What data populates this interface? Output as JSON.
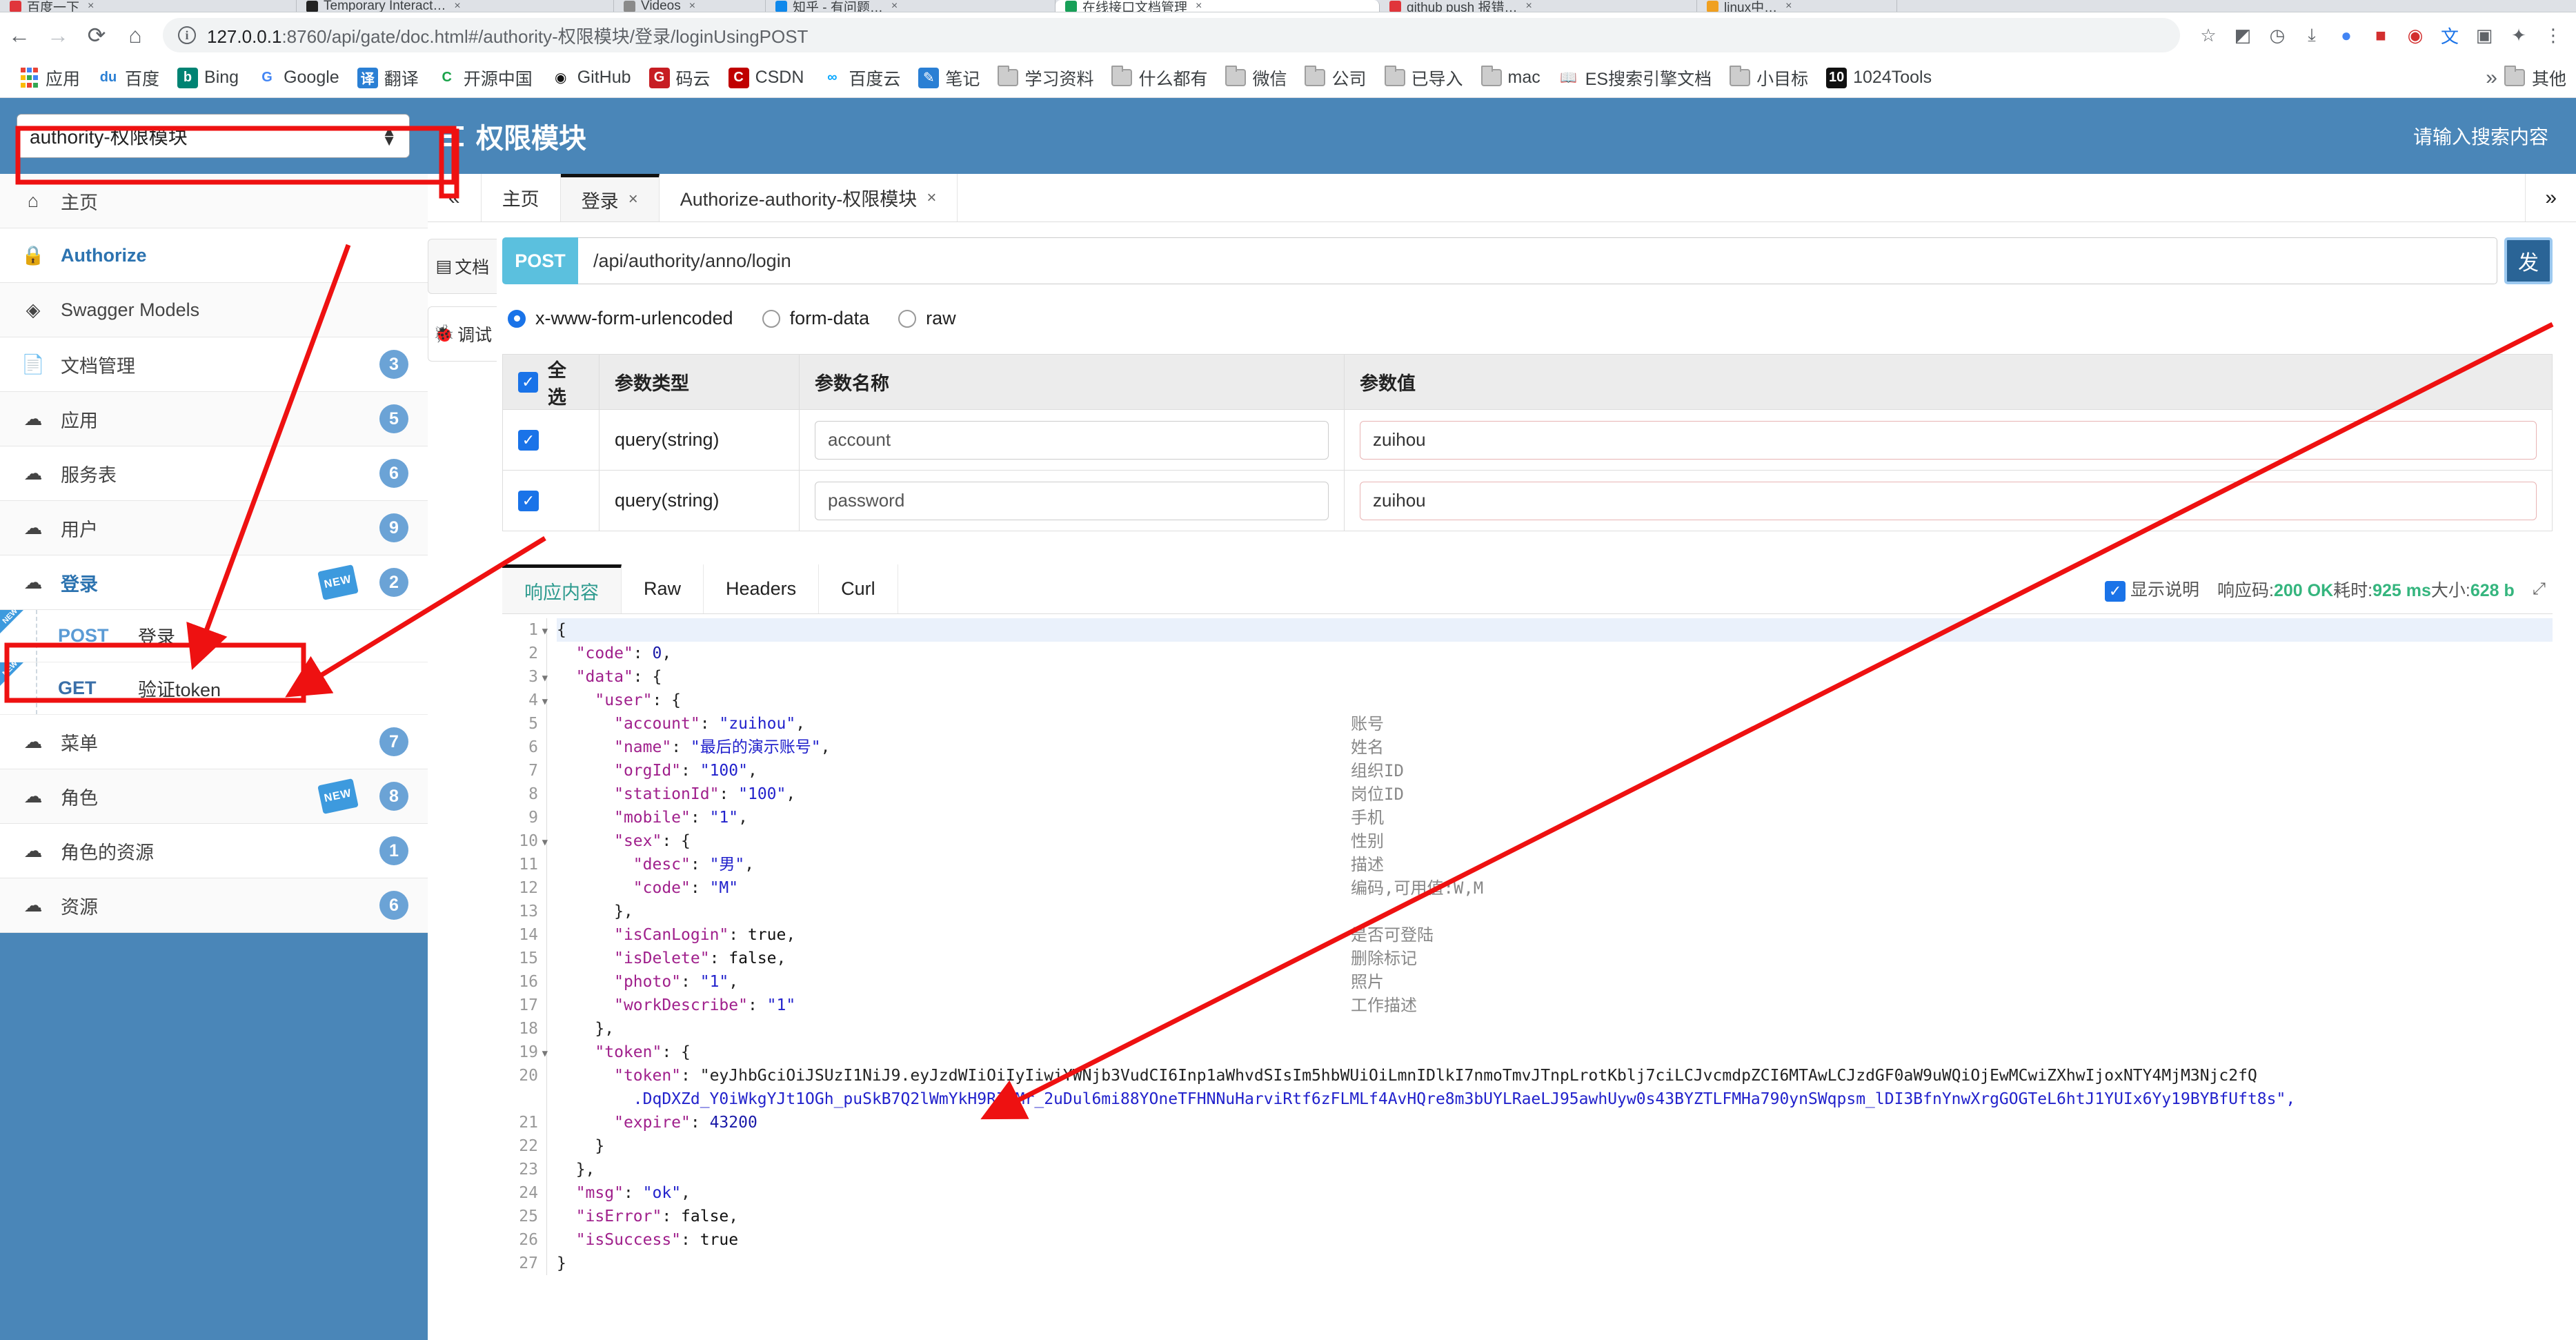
{
  "browser": {
    "tabs": [
      {
        "title": "百度一下",
        "favicon_color": "#e0353b",
        "active": false
      },
      {
        "title": "Temporary Interact…",
        "favicon_color": "#222222",
        "active": false
      },
      {
        "title": "Videos",
        "favicon_color": "#8a8a8a",
        "active": false
      },
      {
        "title": "知乎 - 有问题…",
        "favicon_color": "#0f88eb",
        "active": false
      },
      {
        "title": "在线接口文档管理",
        "favicon_color": "#18a058",
        "active": true
      },
      {
        "title": "github push 报错…",
        "favicon_color": "#e0353b",
        "active": false
      },
      {
        "title": "linux中…",
        "favicon_color": "#f0a020",
        "active": false
      }
    ],
    "nav": {
      "back": "←",
      "forward": "→",
      "reload": "⟳",
      "home": "⌂"
    },
    "url_prefix": "127.0.0.1",
    "url_rest": ":8760/api/gate/doc.html#/authority-权限模块/登录/loginUsingPOST",
    "toolbar_icons": [
      "star-icon",
      "extension-icon",
      "history-icon",
      "download-icon",
      "profile-icon",
      "lastpass-icon",
      "adblock-icon",
      "translate-icon",
      "zip-icon",
      "puzzle-icon",
      "menu-icon"
    ],
    "bookmarks": [
      {
        "label": "应用",
        "icon": "apps-grid-icon",
        "type": "apps"
      },
      {
        "label": "百度",
        "icon": "baidu-icon",
        "type": "site",
        "color": "#2a7fd4"
      },
      {
        "label": "Bing",
        "icon": "bing-icon",
        "type": "site",
        "color": "#008373"
      },
      {
        "label": "Google",
        "icon": "google-icon",
        "type": "site",
        "color": "#4285f4"
      },
      {
        "label": "翻译",
        "icon": "translate-icon",
        "type": "site",
        "color": "#2a7fd4"
      },
      {
        "label": "开源中国",
        "icon": "oschina-icon",
        "type": "site",
        "color": "#1aa34a"
      },
      {
        "label": "GitHub",
        "icon": "github-icon",
        "type": "site",
        "color": "#111111"
      },
      {
        "label": "码云",
        "icon": "gitee-icon",
        "type": "site",
        "color": "#c71d23"
      },
      {
        "label": "CSDN",
        "icon": "csdn-icon",
        "type": "site",
        "color": "#c00000"
      },
      {
        "label": "百度云",
        "icon": "baiduyun-icon",
        "type": "site",
        "color": "#06a7ff"
      },
      {
        "label": "笔记",
        "icon": "note-icon",
        "type": "site",
        "color": "#2a7fd4"
      },
      {
        "label": "学习资料",
        "icon": "folder-icon",
        "type": "folder"
      },
      {
        "label": "什么都有",
        "icon": "folder-icon",
        "type": "folder"
      },
      {
        "label": "微信",
        "icon": "folder-icon",
        "type": "folder"
      },
      {
        "label": "公司",
        "icon": "folder-icon",
        "type": "folder"
      },
      {
        "label": "已导入",
        "icon": "folder-icon",
        "type": "folder"
      },
      {
        "label": "mac",
        "icon": "folder-icon",
        "type": "folder"
      },
      {
        "label": "ES搜索引擎文档",
        "icon": "book-icon",
        "type": "site",
        "color": "#333333"
      },
      {
        "label": "小目标",
        "icon": "folder-icon",
        "type": "folder"
      },
      {
        "label": "1024Tools",
        "icon": "tools-icon",
        "type": "site",
        "color": "#111111"
      }
    ],
    "bookmarks_overflow": "»",
    "other_bookmarks": "其他"
  },
  "app": {
    "module_select": {
      "value": "authority-权限模块"
    },
    "title": "权限模块",
    "search_placeholder": "请输入搜索内容",
    "sidebar": [
      {
        "label": "主页",
        "icon": "home-icon",
        "badge": "",
        "new": false,
        "active": false,
        "type": "nav"
      },
      {
        "label": "Authorize",
        "icon": "lock-icon",
        "badge": "",
        "new": false,
        "active": true,
        "type": "nav"
      },
      {
        "label": "Swagger Models",
        "icon": "model-icon",
        "badge": "",
        "new": false,
        "active": false,
        "type": "nav"
      },
      {
        "label": "文档管理",
        "icon": "doc-gear-icon",
        "badge": "3",
        "new": false,
        "active": false,
        "type": "group"
      },
      {
        "label": "应用",
        "icon": "api-cloud-icon",
        "badge": "5",
        "new": false,
        "active": false,
        "type": "group"
      },
      {
        "label": "服务表",
        "icon": "api-cloud-icon",
        "badge": "6",
        "new": false,
        "active": false,
        "type": "group"
      },
      {
        "label": "用户",
        "icon": "api-cloud-icon",
        "badge": "9",
        "new": false,
        "active": false,
        "type": "group"
      },
      {
        "label": "登录",
        "icon": "api-cloud-icon",
        "badge": "2",
        "new": true,
        "active": true,
        "type": "group"
      }
    ],
    "sidebar_ops": [
      {
        "method": "POST",
        "name": "登录",
        "new": true,
        "selected": true
      },
      {
        "method": "GET",
        "name": "验证token",
        "new": true,
        "selected": false
      }
    ],
    "sidebar_tail": [
      {
        "label": "菜单",
        "icon": "api-cloud-icon",
        "badge": "7",
        "new": false
      },
      {
        "label": "角色",
        "icon": "api-cloud-icon",
        "badge": "8",
        "new": true
      },
      {
        "label": "角色的资源",
        "icon": "api-cloud-icon",
        "badge": "1",
        "new": false
      },
      {
        "label": "资源",
        "icon": "api-cloud-icon",
        "badge": "6",
        "new": false
      }
    ],
    "new_tag": "NEW"
  },
  "content": {
    "collapse_icon": "«",
    "expand_icon": "»",
    "tabs": [
      {
        "label": "主页",
        "closable": false,
        "selected": false
      },
      {
        "label": "登录",
        "closable": true,
        "selected": true
      },
      {
        "label": "Authorize-authority-权限模块",
        "closable": true,
        "selected": false
      }
    ],
    "close_glyph": "×",
    "vtabs": [
      {
        "label": "文档",
        "icon": "document-icon",
        "selected": false
      },
      {
        "label": "调试",
        "icon": "bug-icon",
        "selected": true
      }
    ],
    "request": {
      "method": "POST",
      "url": "/api/authority/anno/login",
      "send_label": "发"
    },
    "body_types": [
      {
        "label": "x-www-form-urlencoded",
        "selected": true
      },
      {
        "label": "form-data",
        "selected": false
      },
      {
        "label": "raw",
        "selected": false
      }
    ],
    "param_table": {
      "headers": [
        "全选",
        "参数类型",
        "参数名称",
        "参数值"
      ],
      "rows": [
        {
          "checked": true,
          "type": "query(string)",
          "name": "account",
          "value": "zuihou"
        },
        {
          "checked": true,
          "type": "query(string)",
          "name": "password",
          "value": "zuihou"
        }
      ]
    },
    "response_tabs": [
      {
        "label": "响应内容",
        "selected": true
      },
      {
        "label": "Raw",
        "selected": false
      },
      {
        "label": "Headers",
        "selected": false
      },
      {
        "label": "Curl",
        "selected": false
      }
    ],
    "response_meta": {
      "show_desc_label": "显示说明",
      "show_desc_checked": true,
      "status_label": "响应码:",
      "status_value": "200 OK",
      "time_label": "耗时:",
      "time_value": "925 ms",
      "size_label": "大小:",
      "size_value": "628 b",
      "expand_icon": "expand-icon"
    },
    "response_code_lines": [
      {
        "n": 1,
        "fold": true,
        "text": "{"
      },
      {
        "n": 2,
        "fold": false,
        "text": "  \"code\": 0,"
      },
      {
        "n": 3,
        "fold": true,
        "text": "  \"data\": {"
      },
      {
        "n": 4,
        "fold": true,
        "text": "    \"user\": {"
      },
      {
        "n": 5,
        "fold": false,
        "text": "      \"account\": \"zuihou\","
      },
      {
        "n": 6,
        "fold": false,
        "text": "      \"name\": \"最后的演示账号\","
      },
      {
        "n": 7,
        "fold": false,
        "text": "      \"orgId\": \"100\","
      },
      {
        "n": 8,
        "fold": false,
        "text": "      \"stationId\": \"100\","
      },
      {
        "n": 9,
        "fold": false,
        "text": "      \"mobile\": \"1\","
      },
      {
        "n": 10,
        "fold": true,
        "text": "      \"sex\": {"
      },
      {
        "n": 11,
        "fold": false,
        "text": "        \"desc\": \"男\","
      },
      {
        "n": 12,
        "fold": false,
        "text": "        \"code\": \"M\""
      },
      {
        "n": 13,
        "fold": false,
        "text": "      },"
      },
      {
        "n": 14,
        "fold": false,
        "text": "      \"isCanLogin\": true,"
      },
      {
        "n": 15,
        "fold": false,
        "text": "      \"isDelete\": false,"
      },
      {
        "n": 16,
        "fold": false,
        "text": "      \"photo\": \"1\","
      },
      {
        "n": 17,
        "fold": false,
        "text": "      \"workDescribe\": \"1\""
      },
      {
        "n": 18,
        "fold": false,
        "text": "    },"
      },
      {
        "n": 19,
        "fold": true,
        "text": "    \"token\": {"
      },
      {
        "n": 20,
        "fold": false,
        "text": "      \"token\": \"eyJhbGciOiJSUzI1NiJ9.eyJzdWIiOiIyIiwiYWNjb3VudCI6Inp1aWhvdSIsIm5hbWUiOiLmnIDlkI7nmoTmvJTnpLrotKblj7ciLCJvcmdpZCI6MTAwLCJzdGF0aW9uWQiOjEwMCwiZXhwIjoxNTY4MjM3Njc2fQ"
      },
      {
        "n": null,
        "fold": false,
        "text": "        .DqDXZd_Y0iWkgYJt1OGh_puSkB7Q2lWmYkH9RZYMr_2uDul6mi88YOneTFHNNuHarviRtf6zFLMLf4AvHQre8m3bUYLRaeLJ95awhUyw0s43BYZTLFMHa790ynSWqpsm_lDI3BfnYnwXrgGOGTeL6htJ1YUIx6Yy19BYBfUft8s\","
      },
      {
        "n": 21,
        "fold": false,
        "text": "      \"expire\": 43200"
      },
      {
        "n": 22,
        "fold": false,
        "text": "    }"
      },
      {
        "n": 23,
        "fold": false,
        "text": "  },"
      },
      {
        "n": 24,
        "fold": false,
        "text": "  \"msg\": \"ok\","
      },
      {
        "n": 25,
        "fold": false,
        "text": "  \"isError\": false,"
      },
      {
        "n": 26,
        "fold": false,
        "text": "  \"isSuccess\": true"
      },
      {
        "n": 27,
        "fold": false,
        "text": "}"
      }
    ],
    "response_descriptions": [
      "",
      "",
      "",
      "",
      "账号",
      "姓名",
      "组织ID",
      "岗位ID",
      "手机",
      "性别",
      "描述",
      "编码,可用值:W,M",
      "",
      "是否可登陆",
      "删除标记",
      "照片",
      "工作描述"
    ]
  },
  "colors": {
    "brand_blue": "#4a86b8",
    "accent_blue": "#2c73b0",
    "post_cyan": "#5bc0de",
    "success_green": "#35b57e",
    "annotation_red": "#ee1111"
  }
}
